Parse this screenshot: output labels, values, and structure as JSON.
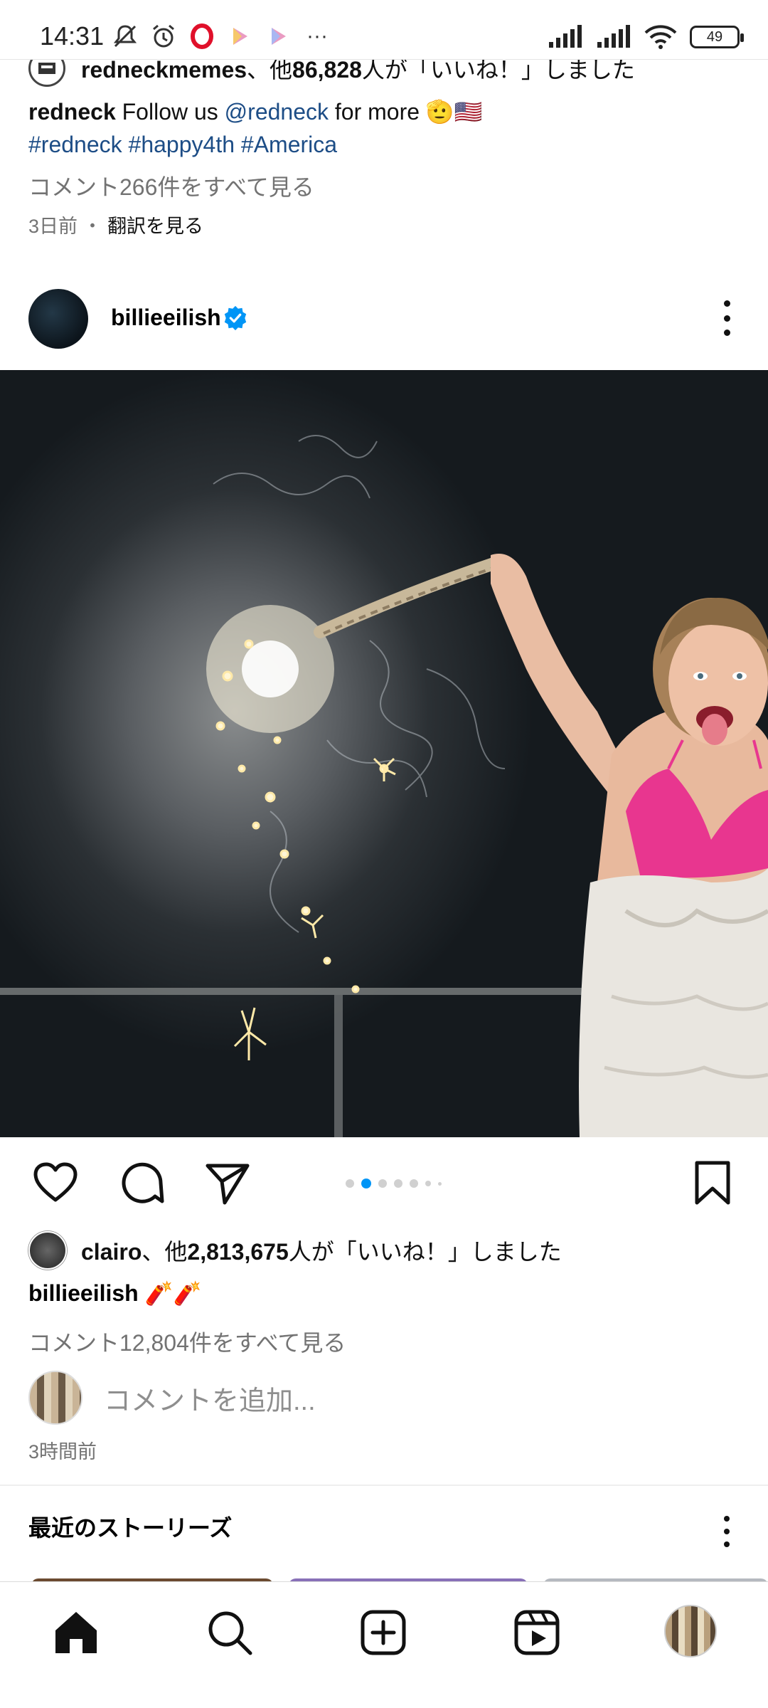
{
  "status_bar": {
    "time": "14:31",
    "battery": "49",
    "more": "···"
  },
  "previous_post": {
    "likes_user": "redneckmemes",
    "likes_suffix": "、他",
    "likes_count": "86,828",
    "likes_tail": "人が「いいね！」しました",
    "caption_user": "redneck",
    "caption_text_1": " Follow us ",
    "caption_mention": "@redneck",
    "caption_text_2": " for more 🫡🇺🇸",
    "hashtags": [
      "#redneck",
      "#happy4th",
      "#America"
    ],
    "view_comments": "コメント266件をすべて見る",
    "time_ago": "3日前",
    "separator": "・",
    "translate": "翻訳を見る"
  },
  "post": {
    "username": "billieeilish",
    "carousel": {
      "count": 7,
      "active": 2
    },
    "likes_user": "clairo",
    "likes_suffix": "、他",
    "likes_count": "2,813,675",
    "likes_tail": "人が「いいね！」しました",
    "caption_user": "billieeilish",
    "caption_emoji": " 🧨🧨",
    "view_comments": "コメント12,804件をすべて見る",
    "add_comment_placeholder": "コメントを追加...",
    "time_ago": "3時間前"
  },
  "stories": {
    "title": "最近のストーリーズ"
  },
  "colors": {
    "link": "#1d4d86",
    "verified": "#0095f6",
    "muted": "#737373",
    "dot_active": "#0095f6",
    "swimsuit": "#e8368f"
  },
  "bottom_nav": {
    "items": [
      "home-icon",
      "search-icon",
      "create-icon",
      "reels-icon",
      "profile-avatar"
    ]
  }
}
